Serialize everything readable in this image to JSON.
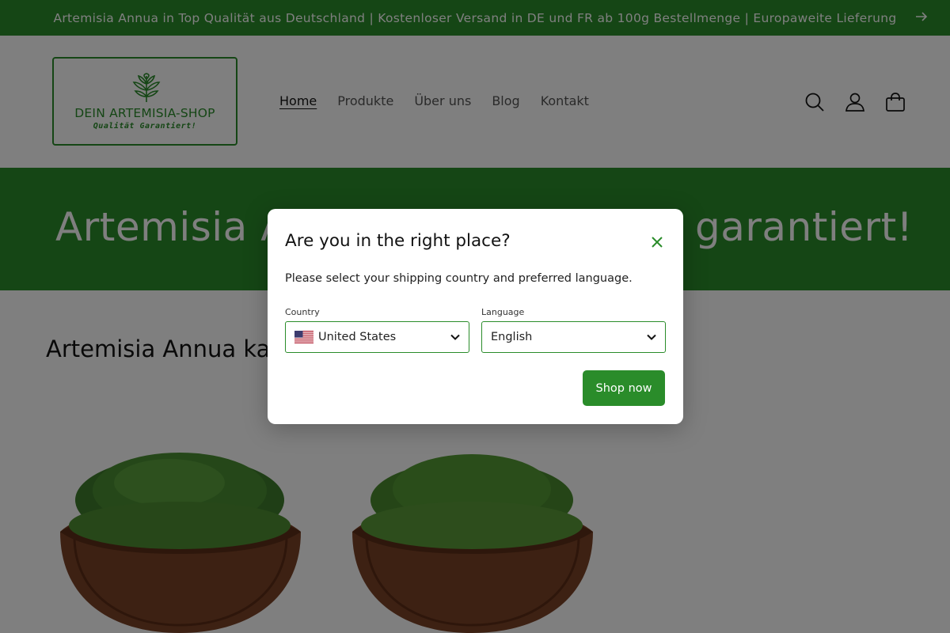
{
  "announcement": {
    "text": "Artemisia Annua in Top Qualität aus Deutschland | Kostenloser Versand in DE und FR ab 100g Bestellmenge | Europaweite Lieferung",
    "arrow_icon": "arrow-right-icon"
  },
  "header": {
    "logo": {
      "line1": "DEIN ARTEMISIA-SHOP",
      "line2": "Qualität Garantiert!",
      "icon": "artemisia-leaf-icon"
    },
    "nav": [
      {
        "label": "Home",
        "active": true
      },
      {
        "label": "Produkte",
        "active": false
      },
      {
        "label": "Über uns",
        "active": false
      },
      {
        "label": "Blog",
        "active": false
      },
      {
        "label": "Kontakt",
        "active": false
      }
    ],
    "icons": [
      "search-icon",
      "account-icon",
      "cart-icon"
    ]
  },
  "hero": {
    "title_left": "Artemisia A",
    "title_right": "garantiert!"
  },
  "section": {
    "title": "Artemisia Annua ka"
  },
  "modal": {
    "title": "Are you in the right place?",
    "description": "Please select your shipping country and preferred language.",
    "country_label": "Country",
    "country_value": "United States",
    "country_flag": "us-flag-icon",
    "language_label": "Language",
    "language_value": "English",
    "button_label": "Shop now"
  },
  "colors": {
    "brand_green": "#2a8c2a",
    "text": "#121212",
    "overlay": "rgba(0,0,0,0.5)"
  }
}
